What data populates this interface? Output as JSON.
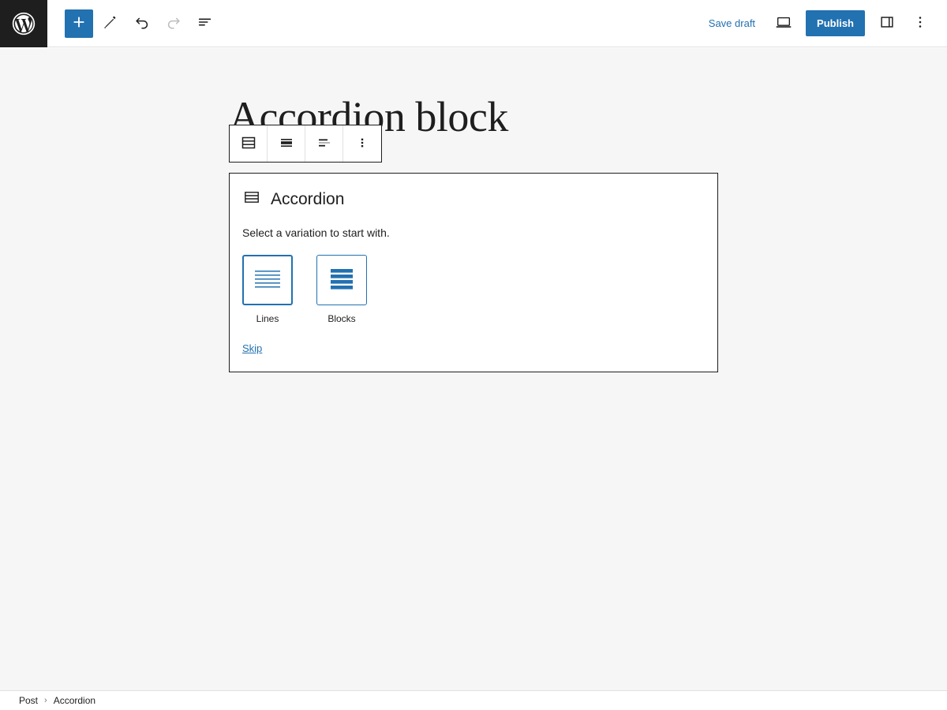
{
  "header": {
    "logo_icon": "wordpress-logo-icon",
    "left_tools": [
      {
        "name": "add-block-button",
        "icon": "plus-icon",
        "label": "Add block",
        "state": "primary"
      },
      {
        "name": "edit-tool-button",
        "icon": "pencil-icon",
        "label": "Tools",
        "state": "default"
      },
      {
        "name": "undo-button",
        "icon": "undo-arrow-icon",
        "label": "Undo",
        "state": "default"
      },
      {
        "name": "redo-button",
        "icon": "redo-arrow-icon",
        "label": "Redo",
        "state": "disabled"
      },
      {
        "name": "document-overview-button",
        "icon": "list-view-icon",
        "label": "Document Overview",
        "state": "default"
      }
    ],
    "save_draft_label": "Save draft",
    "preview_icon": "desktop-preview-icon",
    "preview_label": "Preview",
    "publish_label": "Publish",
    "sidebar_toggle_icon": "sidebar-panel-icon",
    "sidebar_toggle_label": "Settings",
    "options_icon": "vertical-ellipsis-icon",
    "options_label": "Options"
  },
  "document": {
    "post_title": "Accordion block"
  },
  "block_toolbar": {
    "buttons": [
      {
        "name": "block-type-accordion-button",
        "icon": "accordion-block-icon",
        "label": "Accordion"
      },
      {
        "name": "change-alignment-button",
        "icon": "align-wide-icon",
        "label": "Align"
      },
      {
        "name": "change-text-align-button",
        "icon": "text-align-left-icon",
        "label": "Align text"
      },
      {
        "name": "block-more-options-button",
        "icon": "vertical-ellipsis-icon",
        "label": "Options"
      }
    ]
  },
  "accordion_placeholder": {
    "icon": "accordion-block-icon",
    "title": "Accordion",
    "instructions": "Select a variation to start with.",
    "variations": [
      {
        "name": "variation-lines",
        "label": "Lines",
        "icon": "accordion-lines-icon",
        "selected": true
      },
      {
        "name": "variation-blocks",
        "label": "Blocks",
        "icon": "accordion-blocks-icon",
        "selected": false
      }
    ],
    "skip_label": "Skip"
  },
  "footer": {
    "breadcrumb": [
      {
        "name": "breadcrumb-post",
        "label": "Post"
      },
      {
        "name": "breadcrumb-accordion",
        "label": "Accordion"
      }
    ],
    "separator": "›"
  },
  "colors": {
    "accent_blue": "#2271b1",
    "ink": "#1e1e1e",
    "canvas_gray": "#f6f6f6",
    "border_gray": "#e0e0e0",
    "disabled_gray": "#bcbcbc"
  }
}
